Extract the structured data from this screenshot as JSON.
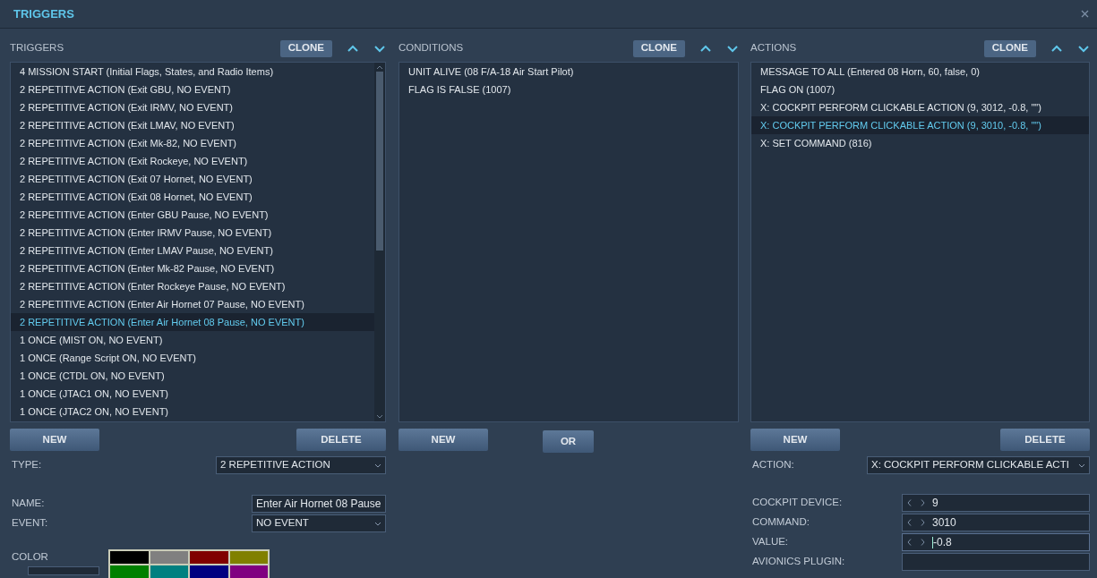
{
  "window": {
    "title": "TRIGGERS"
  },
  "triggers": {
    "heading": "TRIGGERS",
    "clone": "CLONE",
    "items": [
      {
        "label": "4 MISSION START (Initial Flags, States, and Radio Items)",
        "selected": false
      },
      {
        "label": "2 REPETITIVE ACTION (Exit GBU, NO EVENT)",
        "selected": false
      },
      {
        "label": "2 REPETITIVE ACTION (Exit IRMV, NO EVENT)",
        "selected": false
      },
      {
        "label": "2 REPETITIVE ACTION (Exit LMAV, NO EVENT)",
        "selected": false
      },
      {
        "label": "2 REPETITIVE ACTION (Exit Mk-82, NO EVENT)",
        "selected": false
      },
      {
        "label": "2 REPETITIVE ACTION (Exit Rockeye, NO EVENT)",
        "selected": false
      },
      {
        "label": "2 REPETITIVE ACTION (Exit 07 Hornet, NO EVENT)",
        "selected": false
      },
      {
        "label": "2 REPETITIVE ACTION (Exit 08 Hornet, NO EVENT)",
        "selected": false
      },
      {
        "label": "2 REPETITIVE ACTION (Enter GBU Pause, NO EVENT)",
        "selected": false
      },
      {
        "label": "2 REPETITIVE ACTION (Enter IRMV Pause, NO EVENT)",
        "selected": false
      },
      {
        "label": "2 REPETITIVE ACTION (Enter LMAV Pause, NO EVENT)",
        "selected": false
      },
      {
        "label": "2 REPETITIVE ACTION (Enter Mk-82 Pause, NO EVENT)",
        "selected": false
      },
      {
        "label": "2 REPETITIVE ACTION (Enter Rockeye Pause, NO EVENT)",
        "selected": false
      },
      {
        "label": "2 REPETITIVE ACTION (Enter Air Hornet 07 Pause, NO EVENT)",
        "selected": false
      },
      {
        "label": "2 REPETITIVE ACTION (Enter Air Hornet 08 Pause, NO EVENT)",
        "selected": true
      },
      {
        "label": "1 ONCE (MIST ON, NO EVENT)",
        "selected": false
      },
      {
        "label": "1 ONCE (Range Script ON, NO EVENT)",
        "selected": false
      },
      {
        "label": "1 ONCE (CTDL  ON, NO EVENT)",
        "selected": false
      },
      {
        "label": "1 ONCE (JTAC1  ON, NO EVENT)",
        "selected": false
      },
      {
        "label": "1 ONCE (JTAC2  ON, NO EVENT)",
        "selected": false
      }
    ],
    "buttons": [
      "NEW",
      "DELETE"
    ]
  },
  "conditions": {
    "heading": "CONDITIONS",
    "clone": "CLONE",
    "items": [
      {
        "label": "UNIT ALIVE (08 F/A-18 Air Start Pilot)",
        "selected": false
      },
      {
        "label": "FLAG IS FALSE (1007)",
        "selected": false
      }
    ],
    "buttons": [
      "NEW",
      "OR"
    ]
  },
  "actions": {
    "heading": "ACTIONS",
    "clone": "CLONE",
    "items": [
      {
        "label": "MESSAGE TO ALL (Entered 08 Horn, 60, false, 0)",
        "selected": false
      },
      {
        "label": "FLAG ON (1007)",
        "selected": false
      },
      {
        "label": "X: COCKPIT PERFORM CLICKABLE ACTION (9, 3012, -0.8, \"\")",
        "selected": false
      },
      {
        "label": "X: COCKPIT PERFORM CLICKABLE ACTION (9, 3010, -0.8, \"\")",
        "selected": true
      },
      {
        "label": "X: SET COMMAND (816)",
        "selected": false
      }
    ],
    "buttons": [
      "NEW",
      "DELETE"
    ]
  },
  "trigger_form": {
    "type_label": "TYPE:",
    "type_value": "2 REPETITIVE ACTION",
    "name_label": "NAME:",
    "name_value": "Enter Air Hornet 08 Pause",
    "event_label": "EVENT:",
    "event_value": "NO EVENT",
    "color_label": "COLOR",
    "colors": [
      {
        "color": "#000000"
      },
      {
        "color": "#808080"
      },
      {
        "color": "#800000"
      },
      {
        "color": "#808000"
      },
      {
        "color": "#008000"
      },
      {
        "color": "#008080"
      },
      {
        "color": "#000080"
      },
      {
        "color": "#800080"
      }
    ]
  },
  "action_form": {
    "action_label": "ACTION:",
    "action_value": "X: COCKPIT PERFORM CLICKABLE ACTI",
    "fields": [
      {
        "label": "COCKPIT DEVICE:",
        "value": "9",
        "kind": "spin",
        "focused": false
      },
      {
        "label": "COMMAND:",
        "value": "3010",
        "kind": "spin",
        "focused": false
      },
      {
        "label": "VALUE:",
        "value": "-0.8",
        "kind": "spin",
        "focused": true
      },
      {
        "label": "AVIONICS PLUGIN:",
        "kind": "text",
        "focused": false
      }
    ]
  }
}
